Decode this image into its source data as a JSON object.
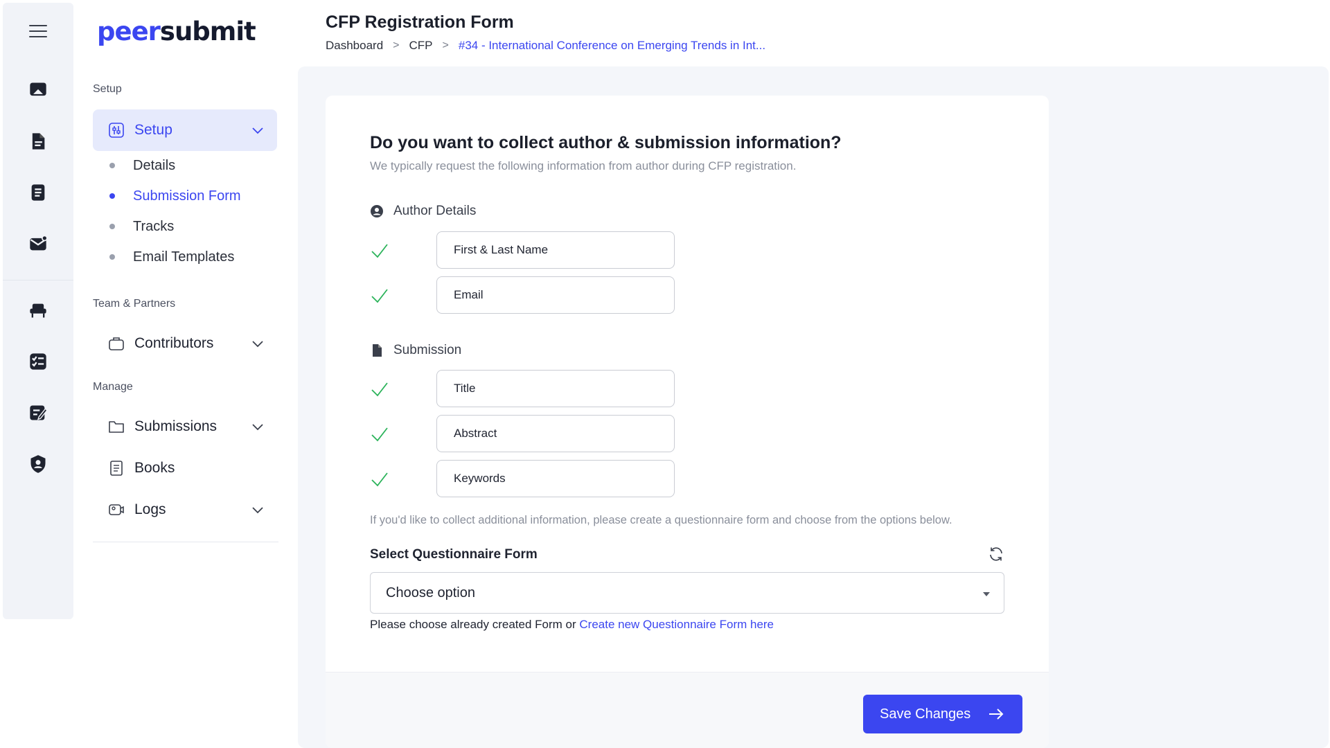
{
  "app": {
    "logo_part1": "peer",
    "logo_part2": "submit"
  },
  "rail": {
    "icons": [
      "menu-icon",
      "presentation-icon",
      "document-icon",
      "list-document-icon",
      "mail-icon",
      "chair-icon",
      "checklist-icon",
      "edit-icon",
      "shield-icon"
    ]
  },
  "sidebar": {
    "section_setup": "Setup",
    "setup_label": "Setup",
    "sub_items": [
      "Details",
      "Submission Form",
      "Tracks",
      "Email Templates"
    ],
    "section_team": "Team & Partners",
    "contributors_label": "Contributors",
    "section_manage": "Manage",
    "submissions_label": "Submissions",
    "books_label": "Books",
    "logs_label": "Logs"
  },
  "header": {
    "title": "CFP Registration Form",
    "breadcrumb": [
      "Dashboard",
      "CFP",
      "#34 - International Conference on Emerging Trends in Int..."
    ],
    "breadcrumb_sep": ">"
  },
  "form": {
    "question": "Do you want to collect author & submission information?",
    "question_sub": "We typically request the following information from author during CFP registration.",
    "author_heading": "Author Details",
    "author_fields": [
      "First & Last Name",
      "Email"
    ],
    "submission_heading": "Submission",
    "submission_fields": [
      "Title",
      "Abstract",
      "Keywords"
    ],
    "hint": "If you'd like to collect additional information, please create a questionnaire form and choose from the options below.",
    "select_label": "Select Questionnaire Form",
    "select_value": "Choose option",
    "helper_text": "Please choose already created Form or ",
    "helper_link": "Create new Questionnaire Form here",
    "save_label": "Save Changes"
  },
  "colors": {
    "accent": "#3b46f0",
    "check": "#2bb35a",
    "active_bg": "#e6eafc"
  }
}
